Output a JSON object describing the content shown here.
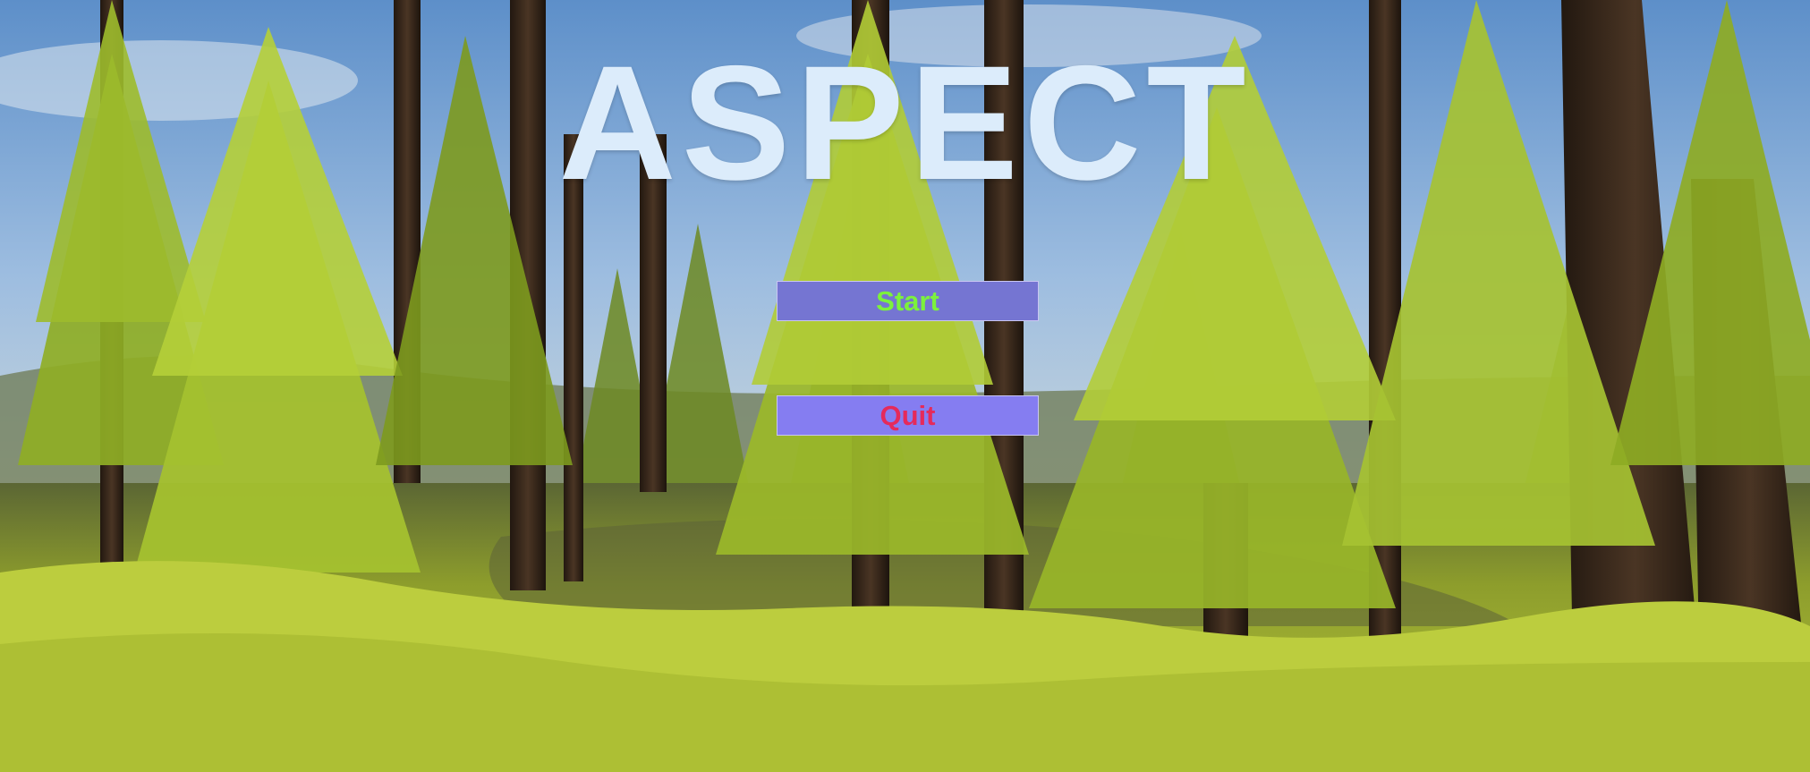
{
  "game": {
    "title": "ASPECT"
  },
  "menu": {
    "start_label": "Start",
    "quit_label": "Quit"
  },
  "colors": {
    "title": "#dcecfb",
    "start_bg": "#7575d2",
    "start_text": "#7cf23c",
    "quit_bg": "#857df1",
    "quit_text": "#e52a5b",
    "sky": "#6f9fd2",
    "foliage": "#8aa51f",
    "grass": "#b5c53a",
    "trunk": "#3a2a1c"
  },
  "background": {
    "scene": "pine-forest"
  }
}
